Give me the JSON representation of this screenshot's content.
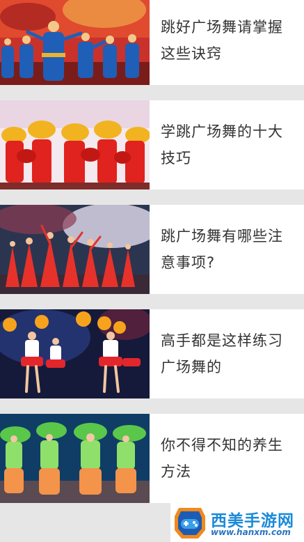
{
  "articles": [
    {
      "title": "跳好广场舞请掌握这些诀窍",
      "thumb_desc": "blue-costume-dancers"
    },
    {
      "title": "学跳广场舞的十大技巧",
      "thumb_desc": "red-fan-dancers"
    },
    {
      "title": "跳广场舞有哪些注意事项?",
      "thumb_desc": "red-dress-dancers"
    },
    {
      "title": "高手都是这样练习广场舞的",
      "thumb_desc": "cheerleader-pompom-dancers"
    },
    {
      "title": "你不得不知的养生方法",
      "thumb_desc": "green-fan-dancers"
    }
  ],
  "watermark": {
    "name": "西美手游网",
    "url": "www.hanxm.com"
  },
  "colors": {
    "background": "#e6e6e6",
    "card": "#ffffff",
    "title_text": "#333333",
    "brand_blue": "#1b8ad8"
  }
}
